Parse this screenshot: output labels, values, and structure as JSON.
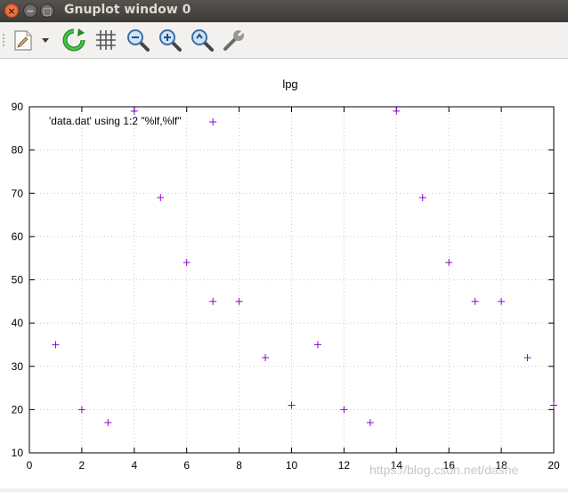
{
  "window": {
    "title": "Gnuplot window 0"
  },
  "toolbar": {
    "icons": [
      "export-icon",
      "dropdown-arrow-icon",
      "replot-icon",
      "grid-icon",
      "zoom-out-icon",
      "zoom-in-icon",
      "zoom-previous-icon",
      "config-wrench-icon"
    ]
  },
  "watermark": "https://blog.csdn.net/dashe",
  "chart_data": {
    "type": "scatter",
    "title": "lpg",
    "legend": "'data.dat' using 1:2 \"%lf,%lf\"",
    "legend_position": "top-left",
    "marker": "+",
    "color": "#9400d3",
    "grid": true,
    "xlim": [
      0,
      20
    ],
    "ylim": [
      10,
      90
    ],
    "xticks": [
      0,
      2,
      4,
      6,
      8,
      10,
      12,
      14,
      16,
      18,
      20
    ],
    "yticks": [
      10,
      20,
      30,
      40,
      50,
      60,
      70,
      80,
      90
    ],
    "x": [
      1,
      2,
      3,
      4,
      5,
      6,
      7,
      7,
      8,
      9,
      10,
      11,
      12,
      13,
      14,
      15,
      16,
      17,
      18,
      19,
      20
    ],
    "y": [
      35,
      20,
      17,
      89,
      69,
      54,
      45,
      86.5,
      45,
      32,
      21,
      35,
      20,
      17,
      89,
      69,
      54,
      45,
      45,
      32,
      21
    ]
  }
}
